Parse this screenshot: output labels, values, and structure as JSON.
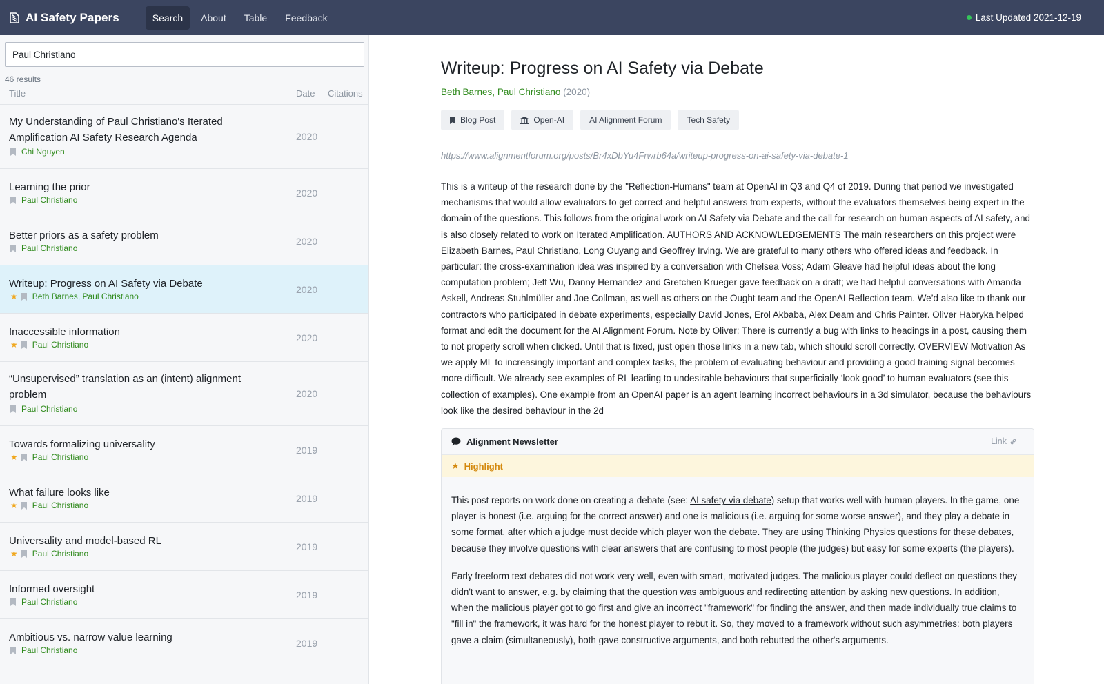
{
  "app": {
    "title": "AI Safety Papers",
    "last_updated": "Last Updated 2021-12-19"
  },
  "nav": [
    "Search",
    "About",
    "Table",
    "Feedback"
  ],
  "search": {
    "value": "Paul Christiano",
    "result_count": "46 results"
  },
  "columns": {
    "title": "Title",
    "date": "Date",
    "citations": "Citations"
  },
  "results": [
    {
      "title": "My Understanding of Paul Christiano's Iterated Amplification AI Safety Research Agenda",
      "authors": [
        "Chi Nguyen"
      ],
      "date": "2020",
      "starred": false
    },
    {
      "title": "Learning the prior",
      "authors": [
        "Paul Christiano"
      ],
      "date": "2020",
      "starred": false
    },
    {
      "title": "Better priors as a safety problem",
      "authors": [
        "Paul Christiano"
      ],
      "date": "2020",
      "starred": false
    },
    {
      "title": "Writeup: Progress on AI Safety via Debate",
      "authors": [
        "Beth Barnes",
        "Paul Christiano"
      ],
      "date": "2020",
      "starred": true,
      "selected": true
    },
    {
      "title": "Inaccessible information",
      "authors": [
        "Paul Christiano"
      ],
      "date": "2020",
      "starred": true
    },
    {
      "title": "“Unsupervised” translation as an (intent) alignment problem",
      "authors": [
        "Paul Christiano"
      ],
      "date": "2020",
      "starred": false
    },
    {
      "title": "Towards formalizing universality",
      "authors": [
        "Paul Christiano"
      ],
      "date": "2019",
      "starred": true
    },
    {
      "title": "What failure looks like",
      "authors": [
        "Paul Christiano"
      ],
      "date": "2019",
      "starred": true
    },
    {
      "title": "Universality and model-based RL",
      "authors": [
        "Paul Christiano"
      ],
      "date": "2019",
      "starred": true
    },
    {
      "title": "Informed oversight",
      "authors": [
        "Paul Christiano"
      ],
      "date": "2019",
      "starred": false
    },
    {
      "title": "Ambitious vs. narrow value learning",
      "authors": [
        "Paul Christiano"
      ],
      "date": "2019",
      "starred": false
    }
  ],
  "detail": {
    "title": "Writeup: Progress on AI Safety via Debate",
    "authors": [
      "Beth Barnes",
      "Paul Christiano"
    ],
    "year": "(2020)",
    "tags": [
      {
        "label": "Blog Post",
        "icon": "bookmark-icon"
      },
      {
        "label": "Open-AI",
        "icon": "institution-icon"
      },
      {
        "label": "AI Alignment Forum",
        "icon": ""
      },
      {
        "label": "Tech Safety",
        "icon": ""
      }
    ],
    "url": "https://www.alignmentforum.org/posts/Br4xDbYu4Frwrb64a/writeup-progress-on-ai-safety-via-debate-1",
    "abstract": "This is a writeup of the research done by the \"Reflection-Humans\" team at OpenAI in Q3 and Q4 of 2019. During that period we investigated mechanisms that would allow evaluators to get correct and helpful answers from experts, without the evaluators themselves being expert in the domain of the questions. This follows from the original work on AI Safety via Debate and the call for research on human aspects of AI safety, and is also closely related to work on Iterated Amplification. AUTHORS AND ACKNOWLEDGEMENTS The main researchers on this project were Elizabeth Barnes, Paul Christiano, Long Ouyang and Geoffrey Irving. We are grateful to many others who offered ideas and feedback. In particular: the cross-examination idea was inspired by a conversation with Chelsea Voss; Adam Gleave had helpful ideas about the long computation problem; Jeff Wu, Danny Hernandez and Gretchen Krueger gave feedback on a draft; we had helpful conversations with Amanda Askell, Andreas Stuhlmüller and Joe Collman, as well as others on the Ought team and the OpenAI Reflection team. We’d also like to thank our contractors who participated in debate experiments, especially David Jones, Erol Akbaba, Alex Deam and Chris Painter. Oliver Habryka helped format and edit the document for the AI Alignment Forum. Note by Oliver: There is currently a bug with links to headings in a post, causing them to not properly scroll when clicked. Until that is fixed, just open those links in a new tab, which should scroll correctly. OVERVIEW Motivation As we apply ML to increasingly important and complex tasks, the problem of evaluating behaviour and providing a good training signal becomes more difficult. We already see examples of RL leading to undesirable behaviours that superficially ‘look good’ to human evaluators (see this collection of examples). One example from an OpenAI paper is an agent learning incorrect behaviours in a 3d simulator, because the behaviours look like the desired behaviour in the 2d",
    "newsletter": {
      "title": "Alignment Newsletter",
      "link_label": "Link",
      "highlight_label": "Highlight",
      "p1_before": "This post reports on work done on creating a debate (see: ",
      "p1_link": "AI safety via debate",
      "p1_after": ") setup that works well with human players. In the game, one player is honest (i.e. arguing for the correct answer) and one is malicious (i.e. arguing for some worse answer), and they play a debate in some format, after which a judge must decide which player won the debate. They are using Thinking Physics questions for these debates, because they involve questions with clear answers that are confusing to most people (the judges) but easy for some experts (the players).",
      "p2": "Early freeform text debates did not work very well, even with smart, motivated judges. The malicious player could deflect on questions they didn't want to answer, e.g. by claiming that the question was ambiguous and redirecting attention by asking new questions. In addition, when the malicious player got to go first and give an incorrect \"framework\" for finding the answer, and then made individually true claims to \"fill in\" the framework, it was hard for the honest player to rebut it. So, they moved to a framework without such asymmetries: both players gave a claim (simultaneously), both gave constructive arguments, and both rebutted the other's arguments."
    }
  },
  "colors": {
    "topbar": "#3b4560",
    "author_green": "#2f8a1c",
    "selected_row": "#def2fa",
    "star": "#f0a820",
    "status_dot": "#35c45a"
  }
}
